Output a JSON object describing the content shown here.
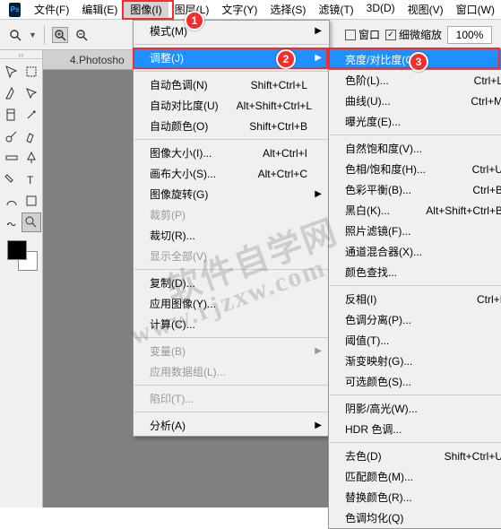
{
  "menubar": {
    "items": [
      "文件(F)",
      "编辑(E)",
      "图像(I)",
      "图层(L)",
      "文字(Y)",
      "选择(S)",
      "滤镜(T)",
      "3D(D)",
      "视图(V)",
      "窗口(W)"
    ],
    "activeIndex": 2
  },
  "toolbar": {
    "checkbox1_label": "窗口",
    "checkbox2_label": "细微缩放",
    "zoom_value": "100%"
  },
  "tab": {
    "label": "4.Photosho"
  },
  "menu_image": {
    "items": [
      {
        "label": "模式(M)",
        "arrow": true
      },
      {
        "divider": true
      },
      {
        "label": "调整(J)",
        "arrow": true,
        "hover": true
      },
      {
        "divider": true
      },
      {
        "label": "自动色调(N)",
        "sc": "Shift+Ctrl+L"
      },
      {
        "label": "自动对比度(U)",
        "sc": "Alt+Shift+Ctrl+L"
      },
      {
        "label": "自动颜色(O)",
        "sc": "Shift+Ctrl+B"
      },
      {
        "divider": true
      },
      {
        "label": "图像大小(I)...",
        "sc": "Alt+Ctrl+I"
      },
      {
        "label": "画布大小(S)...",
        "sc": "Alt+Ctrl+C"
      },
      {
        "label": "图像旋转(G)",
        "arrow": true
      },
      {
        "label": "裁剪(P)",
        "disabled": true
      },
      {
        "label": "裁切(R)..."
      },
      {
        "label": "显示全部(V)",
        "disabled": true
      },
      {
        "divider": true
      },
      {
        "label": "复制(D)..."
      },
      {
        "label": "应用图像(Y)..."
      },
      {
        "label": "计算(C)..."
      },
      {
        "divider": true
      },
      {
        "label": "变量(B)",
        "arrow": true,
        "disabled": true
      },
      {
        "label": "应用数据组(L)...",
        "disabled": true
      },
      {
        "divider": true
      },
      {
        "label": "陷印(T)...",
        "disabled": true
      },
      {
        "divider": true
      },
      {
        "label": "分析(A)",
        "arrow": true
      }
    ]
  },
  "menu_adjust": {
    "items": [
      {
        "label": "亮度/对比度(C)...",
        "hover": true
      },
      {
        "label": "色阶(L)...",
        "sc": "Ctrl+L"
      },
      {
        "label": "曲线(U)...",
        "sc": "Ctrl+M"
      },
      {
        "label": "曝光度(E)..."
      },
      {
        "divider": true
      },
      {
        "label": "自然饱和度(V)..."
      },
      {
        "label": "色相/饱和度(H)...",
        "sc": "Ctrl+U"
      },
      {
        "label": "色彩平衡(B)...",
        "sc": "Ctrl+B"
      },
      {
        "label": "黑白(K)...",
        "sc": "Alt+Shift+Ctrl+B"
      },
      {
        "label": "照片滤镜(F)..."
      },
      {
        "label": "通道混合器(X)..."
      },
      {
        "label": "颜色查找..."
      },
      {
        "divider": true
      },
      {
        "label": "反相(I)",
        "sc": "Ctrl+I"
      },
      {
        "label": "色调分离(P)..."
      },
      {
        "label": "阈值(T)..."
      },
      {
        "label": "渐变映射(G)..."
      },
      {
        "label": "可选颜色(S)..."
      },
      {
        "divider": true
      },
      {
        "label": "阴影/高光(W)..."
      },
      {
        "label": "HDR 色调..."
      },
      {
        "divider": true
      },
      {
        "label": "去色(D)",
        "sc": "Shift+Ctrl+U"
      },
      {
        "label": "匹配颜色(M)..."
      },
      {
        "label": "替换颜色(R)..."
      },
      {
        "label": "色调均化(Q)"
      }
    ]
  },
  "watermark": {
    "line1": "软件自学网",
    "line2": "www.rjzxw.com"
  },
  "markers": {
    "m1": "1",
    "m2": "2",
    "m3": "3"
  }
}
